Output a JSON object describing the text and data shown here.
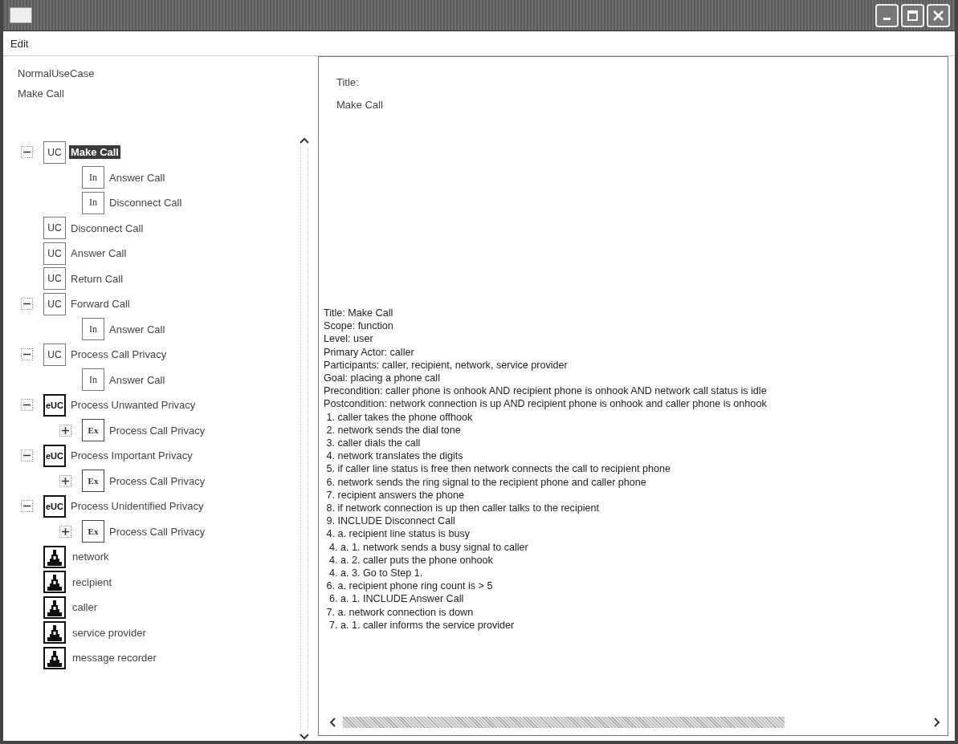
{
  "menu": [
    "Edit"
  ],
  "header": {
    "type_label": "NormalUseCase",
    "name": "Make Call"
  },
  "tree": [
    {
      "label": "Make Call",
      "kind": "use_case",
      "badge": "UC",
      "selected": true,
      "expanded": true,
      "children": [
        {
          "label": "Answer Call",
          "kind": "include",
          "badge": "In",
          "selected": false
        },
        {
          "label": "Disconnect Call",
          "kind": "include",
          "badge": "In",
          "selected": false
        }
      ]
    },
    {
      "label": "Disconnect Call",
      "kind": "use_case",
      "badge": "UC",
      "selected": false
    },
    {
      "label": "Answer Call",
      "kind": "use_case",
      "badge": "UC",
      "selected": false
    },
    {
      "label": "Return Call",
      "kind": "use_case",
      "badge": "UC",
      "selected": false
    },
    {
      "label": "Forward Call",
      "kind": "use_case",
      "badge": "UC",
      "selected": false,
      "expanded": true,
      "children": [
        {
          "label": "Answer Call",
          "kind": "include",
          "badge": "In",
          "selected": false
        }
      ]
    },
    {
      "label": "Process Call Privacy",
      "kind": "use_case",
      "badge": "UC",
      "selected": false,
      "expanded": true,
      "children": [
        {
          "label": "Answer Call",
          "kind": "include",
          "badge": "In",
          "selected": false
        }
      ]
    },
    {
      "label": "Process Unwanted Privacy",
      "kind": "extended_use_case",
      "badge": "eUC",
      "selected": false,
      "expanded": true,
      "children": [
        {
          "label": "Process Call Privacy",
          "kind": "extend",
          "badge": "Ex",
          "selected": false,
          "expanded": false
        }
      ]
    },
    {
      "label": "Process Important Privacy",
      "kind": "extended_use_case",
      "badge": "eUC",
      "selected": false,
      "expanded": true,
      "children": [
        {
          "label": "Process Call Privacy",
          "kind": "extend",
          "badge": "Ex",
          "selected": false,
          "expanded": false
        }
      ]
    },
    {
      "label": "Process Unidentified Privacy",
      "kind": "extended_use_case",
      "badge": "eUC",
      "selected": false,
      "expanded": true,
      "children": [
        {
          "label": "Process Call Privacy",
          "kind": "extend",
          "badge": "Ex",
          "selected": false,
          "expanded": false
        }
      ]
    },
    {
      "label": "network",
      "kind": "actor",
      "selected": false
    },
    {
      "label": "recipient",
      "kind": "actor",
      "selected": false
    },
    {
      "label": "caller",
      "kind": "actor",
      "selected": false
    },
    {
      "label": "service provider",
      "kind": "actor",
      "selected": false
    },
    {
      "label": "message recorder",
      "kind": "actor",
      "selected": false
    }
  ],
  "detail": {
    "title_label": "Title:",
    "title_value": "Make Call",
    "description": [
      "Title: Make Call",
      "Scope: function",
      "Level: user",
      "Primary Actor: caller",
      "Participants: caller, recipient, network, service provider",
      "Goal: placing a phone call",
      "Precondition: caller phone is onhook AND recipient phone is onhook AND network call status is idle",
      "Postcondition: network connection is up AND recipient phone is onhook and caller phone is onhook",
      " 1. caller takes the phone offhook",
      " 2. network sends the dial tone",
      " 3. caller dials the call",
      " 4. network translates the digits",
      " 5. if caller line status is free then network connects the call to recipient phone",
      " 6. network sends the ring signal to the recipient phone and caller phone",
      " 7. recipient answers the phone",
      " 8. if network connection is up then caller talks to the recipient",
      " 9. INCLUDE Disconnect Call",
      " 4. a. recipient line status is busy",
      "  4. a. 1. network sends a busy signal to caller",
      "  4. a. 2. caller puts the phone onhook",
      "  4. a. 3. Go to Step 1.",
      " 6. a. recipient phone ring count is > 5",
      "  6. a. 1. INCLUDE Answer Call",
      " 7. a. network connection is down",
      "  7. a. 1. caller informs the service provider"
    ]
  }
}
